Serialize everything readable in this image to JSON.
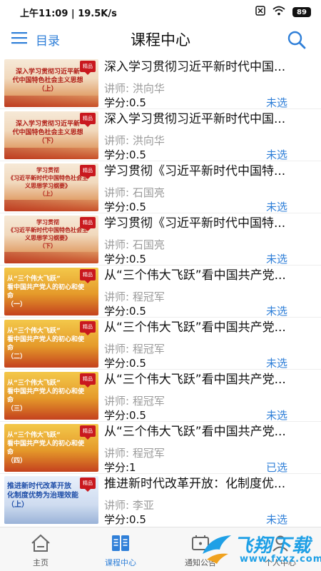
{
  "status_bar": {
    "time": "上午11:09",
    "speed": "19.5K/s",
    "battery": "89"
  },
  "header": {
    "menu_label": "目录",
    "title": "课程中心"
  },
  "courses": [
    {
      "title": "深入学习贯彻习近平新时代中国...",
      "teacher": "讲师: 洪向华",
      "credit": "学分:0.5",
      "status": "未选",
      "thumb_line1": "深入学习贯彻习近平新",
      "thumb_line2": "代中国特色社会主义思想",
      "thumb_line3": "（上）",
      "badge": "精品"
    },
    {
      "title": "深入学习贯彻习近平新时代中国...",
      "teacher": "讲师: 洪向华",
      "credit": "学分:0.5",
      "status": "未选",
      "thumb_line1": "深入学习贯彻习近平新",
      "thumb_line2": "代中国特色社会主义思想",
      "thumb_line3": "（下）",
      "badge": "精品"
    },
    {
      "title": "学习贯彻《习近平新时代中国特...",
      "teacher": "讲师: 石国亮",
      "credit": "学分:0.5",
      "status": "未选",
      "thumb_line1": "学习贯彻",
      "thumb_line2": "《习近平新时代中国特色社会主义思想学习纲要》",
      "thumb_line3": "（上）",
      "badge": "精品"
    },
    {
      "title": "学习贯彻《习近平新时代中国特...",
      "teacher": "讲师: 石国亮",
      "credit": "学分:0.5",
      "status": "未选",
      "thumb_line1": "学习贯彻",
      "thumb_line2": "《习近平新时代中国特色社会主义思想学习纲要》",
      "thumb_line3": "（下）",
      "badge": "精品"
    },
    {
      "title": "从“三个伟大飞跃”看中国共产党...",
      "teacher": "讲师: 程冠军",
      "credit": "学分:0.5",
      "status": "未选",
      "thumb_line1": "从“三个伟大飞跃”",
      "thumb_line2": "看中国共产党人的初心和使命",
      "thumb_line3": "（一）",
      "badge": "精品"
    },
    {
      "title": "从“三个伟大飞跃”看中国共产党...",
      "teacher": "讲师: 程冠军",
      "credit": "学分:0.5",
      "status": "未选",
      "thumb_line1": "从“三个伟大飞跃”",
      "thumb_line2": "看中国共产党人的初心和使命",
      "thumb_line3": "（二）",
      "badge": "精品"
    },
    {
      "title": "从“三个伟大飞跃”看中国共产党...",
      "teacher": "讲师: 程冠军",
      "credit": "学分:0.5",
      "status": "未选",
      "thumb_line1": "从“三个伟大飞跃”",
      "thumb_line2": "看中国共产党人的初心和使命",
      "thumb_line3": "（三）",
      "badge": "精品"
    },
    {
      "title": "从“三个伟大飞跃”看中国共产党...",
      "teacher": "讲师: 程冠军",
      "credit": "学分:1",
      "status": "已选",
      "thumb_line1": "从“三个伟大飞跃”",
      "thumb_line2": "看中国共产党人的初心和使命",
      "thumb_line3": "（四）",
      "badge": "精品"
    },
    {
      "title": "推进新时代改革开放：化制度优...",
      "teacher": "讲师: 李亚",
      "credit": "学分:0.5",
      "status": "未选",
      "thumb_line1": "推进新时代改革开放",
      "thumb_line2": "化制度优势为治理效能",
      "thumb_line3": "（上）",
      "badge": "精品"
    }
  ],
  "bottom_nav": [
    {
      "label": "主页",
      "icon": "home-icon"
    },
    {
      "label": "课程中心",
      "icon": "book-icon",
      "active": true
    },
    {
      "label": "通知公告",
      "icon": "notice-icon"
    },
    {
      "label": "个人中心",
      "icon": "person-icon"
    }
  ],
  "watermark": {
    "text": "飞翔下载",
    "url": "www.fxxz.com"
  },
  "colors": {
    "accent": "#2f7fd8",
    "badge": "#c9181e"
  }
}
